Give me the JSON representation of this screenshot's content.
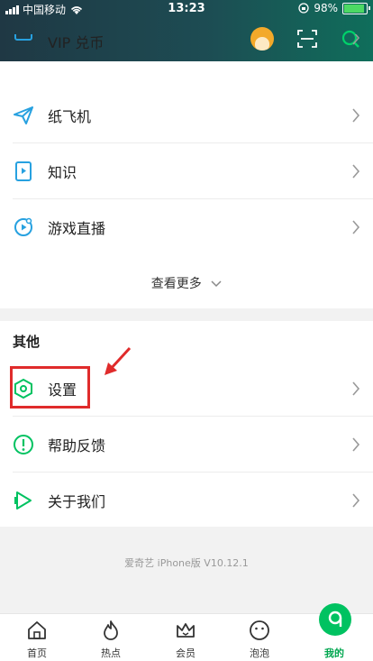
{
  "status_bar": {
    "carrier": "中国移动",
    "time": "13:23",
    "battery": "98%"
  },
  "top_icons": [
    "avatar",
    "scan-icon",
    "search-icon"
  ],
  "menu": {
    "partial_label": "VIP 兑币",
    "items": [
      {
        "label": "纸飞机",
        "icon": "paper-plane-icon"
      },
      {
        "label": "知识",
        "icon": "book-icon"
      },
      {
        "label": "游戏直播",
        "icon": "game-live-icon"
      }
    ],
    "more_label": "查看更多"
  },
  "other_section": {
    "title": "其他",
    "items": [
      {
        "label": "设置",
        "icon": "settings-hex-icon",
        "highlighted": true
      },
      {
        "label": "帮助反馈",
        "icon": "help-icon"
      },
      {
        "label": "关于我们",
        "icon": "about-icon"
      }
    ]
  },
  "version_text": "爱奇艺 iPhone版 V10.12.1",
  "tab_bar": {
    "tabs": [
      {
        "label": "首页",
        "icon": "home-icon"
      },
      {
        "label": "热点",
        "icon": "flame-icon"
      },
      {
        "label": "会员",
        "icon": "crown-icon"
      },
      {
        "label": "泡泡",
        "icon": "bubble-icon"
      },
      {
        "label": "我的",
        "icon": "profile-icon",
        "active": true
      }
    ]
  },
  "colors": {
    "accent": "#00c261",
    "highlight": "#e02b2b",
    "header": "#1d4c53"
  }
}
